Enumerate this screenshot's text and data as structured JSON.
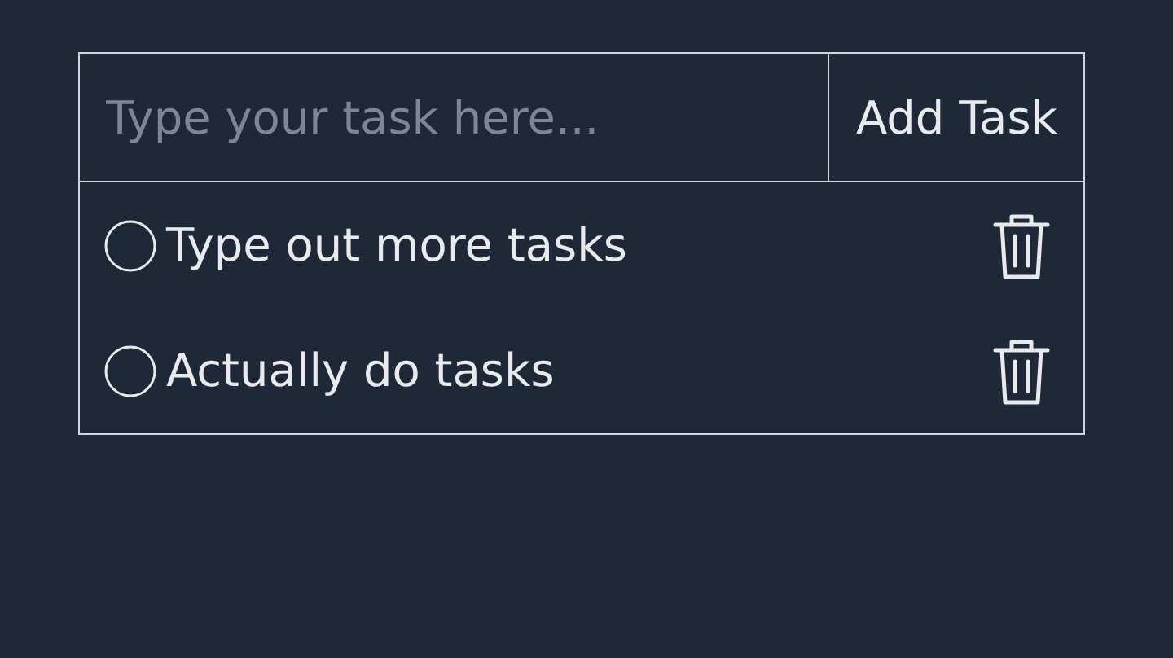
{
  "input": {
    "placeholder": "Type your task here..."
  },
  "add_button": {
    "label": "Add Task"
  },
  "tasks": [
    {
      "text": "Type out more tasks",
      "checked": false
    },
    {
      "text": "Actually do tasks",
      "checked": false
    }
  ]
}
